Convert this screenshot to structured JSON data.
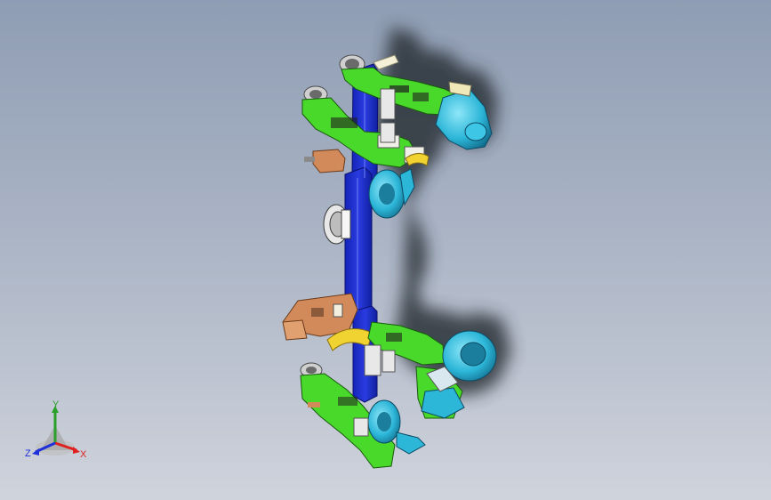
{
  "viewport": {
    "background_top": "#8f9db4",
    "background_bottom": "#cfd3dc"
  },
  "model": {
    "part_colors": {
      "column": "#1f2fd0",
      "arm": "#49d92a",
      "mount": "#2cb6d8",
      "bracket": "#d28a5a",
      "clamp": "#f0d230",
      "plate": "#dadada"
    }
  },
  "triad": {
    "x_label": "X",
    "y_label": "Y",
    "z_label": "Z",
    "x_color": "#e02020",
    "y_color": "#2aa02a",
    "z_color": "#2030d8"
  }
}
